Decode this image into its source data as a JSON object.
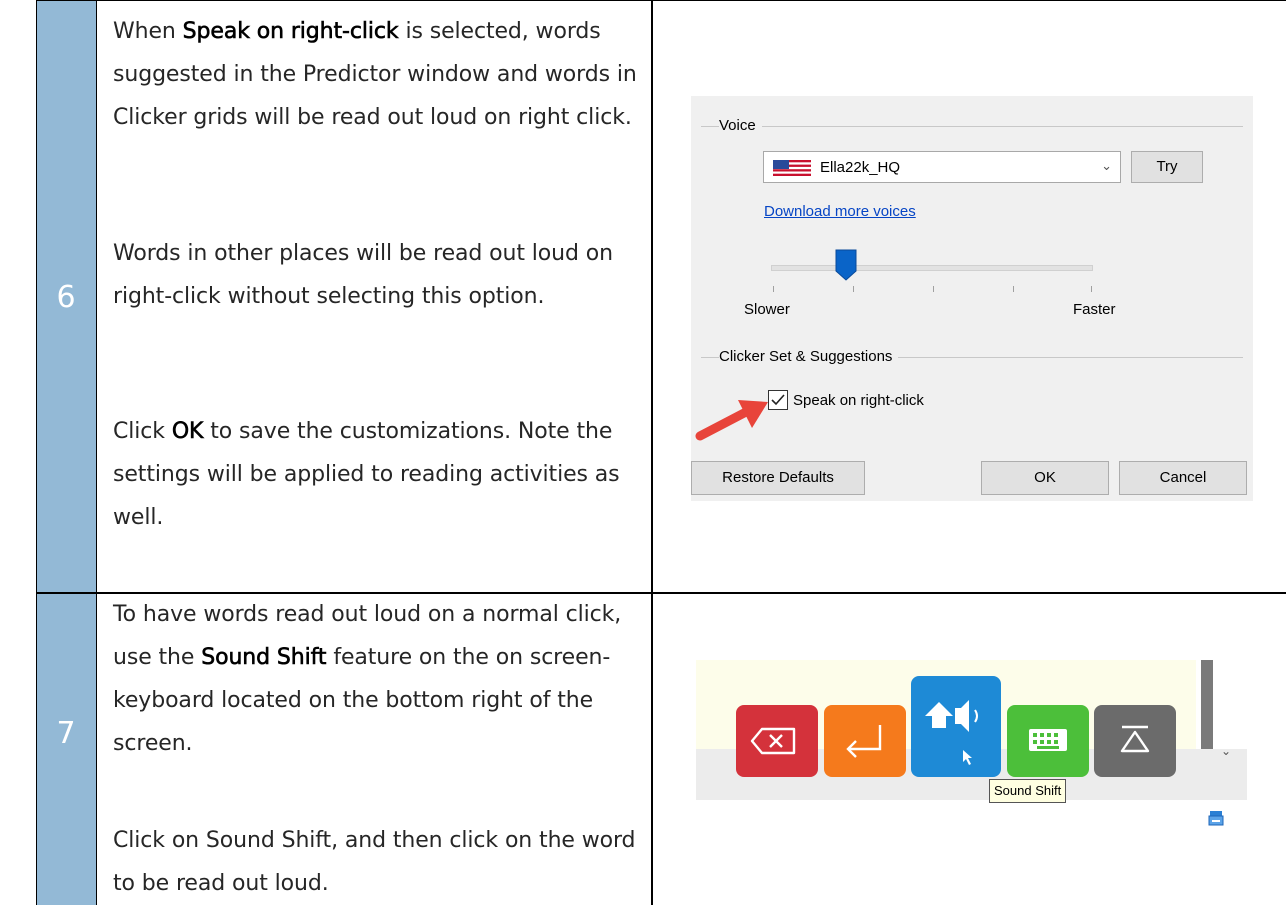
{
  "rows": [
    {
      "number": "6",
      "paragraphs": [
        {
          "pre": "When ",
          "bold": "Speak on right-click",
          "post": " is selected, words suggested in the Predictor window and words in Clicker grids will be read out loud on right click."
        },
        {
          "text": "Words in other places will be read out loud on right-click without selecting this option."
        },
        {
          "pre": "Click ",
          "bold": "OK",
          "post": " to save the customizations. Note the settings will be applied to reading activities as well."
        }
      ]
    },
    {
      "number": "7",
      "paragraphs": [
        {
          "pre": "To have words read out loud on a normal click, use the ",
          "bold": "Sound Shift",
          "post": " feature on the on screen-keyboard located on the bottom right of the screen."
        },
        {
          "text": "Click on Sound Shift, and then click on the word to be read out loud."
        }
      ]
    }
  ],
  "dialog": {
    "voice_group_label": "Voice",
    "voice_selected": "Ella22k_HQ",
    "try_button": "Try",
    "download_link": "Download more voices",
    "slider_min_label": "Slower",
    "slider_max_label": "Faster",
    "slider_value_fraction": 0.22,
    "clicker_group_label": "Clicker Set & Suggestions",
    "speak_checkbox_label": "Speak on right-click",
    "speak_checkbox_checked": true,
    "restore_button": "Restore Defaults",
    "ok_button": "OK",
    "cancel_button": "Cancel"
  },
  "keyboard": {
    "keys": [
      {
        "name": "backspace-key",
        "color": "#d4323b",
        "icon": "backspace-icon"
      },
      {
        "name": "enter-key",
        "color": "#f57a1c",
        "icon": "enter-icon"
      },
      {
        "name": "sound-shift-key",
        "color": "#1e8ad6",
        "icon": "sound-shift-icon"
      },
      {
        "name": "keyboard-key",
        "color": "#4cbf3a",
        "icon": "keyboard-icon"
      },
      {
        "name": "hide-keyboard-key",
        "color": "#6b6b6b",
        "icon": "eject-icon"
      }
    ],
    "tooltip": "Sound Shift"
  }
}
